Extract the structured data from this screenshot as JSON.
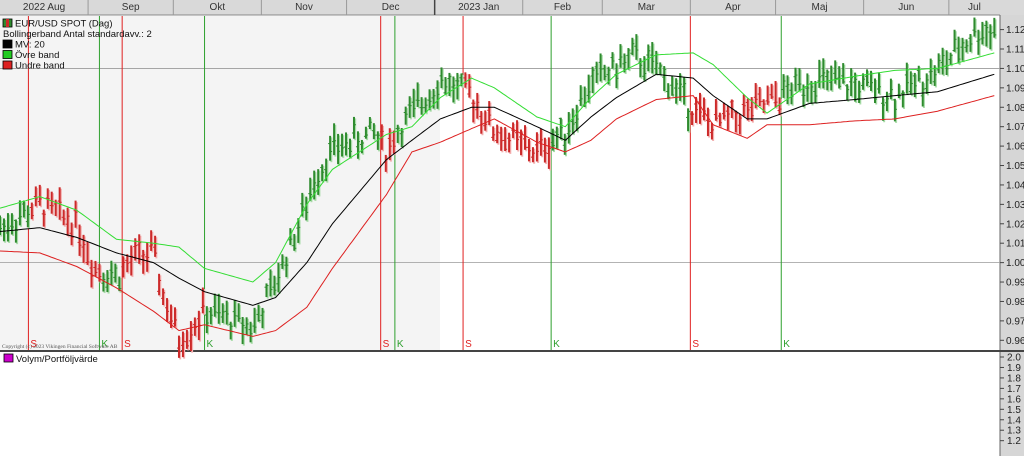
{
  "chart_data": {
    "type": "ohlc",
    "title": "EUR/USD SPOT (Dag)",
    "legend": [
      {
        "label": "EUR/USD SPOT (Dag)",
        "color": "#2e8b2e",
        "marker": "candle"
      },
      {
        "label": "Bollingerband  Antal standardavv.: 2",
        "color": "",
        "marker": "none"
      },
      {
        "label": "MV: 20",
        "color": "#000000",
        "marker": "box"
      },
      {
        "label": "Övre band",
        "color": "#22cc22",
        "marker": "box"
      },
      {
        "label": "Undre band",
        "color": "#dd2222",
        "marker": "box"
      }
    ],
    "months": [
      "2022 Aug",
      "Sep",
      "Okt",
      "Nov",
      "Dec",
      "2023 Jan",
      "Feb",
      "Mar",
      "Apr",
      "Maj",
      "Jun",
      "Jul"
    ],
    "y_ticks": [
      "1.12",
      "1.11",
      "1.10",
      "1.09",
      "1.08",
      "1.07",
      "1.06",
      "1.05",
      "1.04",
      "1.03",
      "1.02",
      "1.01",
      "1.00",
      "0.99",
      "0.98",
      "0.97",
      "0.96"
    ],
    "ylim": [
      0.955,
      1.127
    ],
    "x_range_days": [
      0,
      352
    ],
    "price": {
      "days": [
        0,
        14,
        27,
        33,
        41,
        48,
        54,
        57,
        63,
        72,
        89,
        97,
        108,
        111,
        117,
        132,
        136,
        139,
        145,
        155,
        166,
        174,
        189,
        199,
        208,
        217,
        223,
        231,
        244,
        251,
        270,
        285,
        301,
        315,
        330,
        343,
        350
      ],
      "values": [
        1.018,
        1.03,
        1.02,
        0.998,
        0.993,
        1.003,
        1.005,
        0.985,
        0.96,
        0.975,
        0.967,
        0.99,
        1.03,
        1.045,
        1.058,
        1.067,
        1.057,
        1.066,
        1.077,
        1.094,
        1.086,
        1.068,
        1.057,
        1.068,
        1.093,
        1.101,
        1.106,
        1.1,
        1.079,
        1.071,
        1.082,
        1.094,
        1.091,
        1.086,
        1.099,
        1.118,
        1.121
      ]
    },
    "mv20": {
      "days": [
        0,
        14,
        27,
        41,
        54,
        63,
        72,
        89,
        97,
        108,
        117,
        136,
        145,
        155,
        166,
        174,
        189,
        199,
        208,
        217,
        231,
        244,
        251,
        263,
        270,
        285,
        301,
        315,
        330,
        350
      ],
      "values": [
        1.016,
        1.018,
        1.013,
        1.005,
        1.0,
        0.992,
        0.985,
        0.978,
        0.982,
        1.0,
        1.02,
        1.053,
        1.063,
        1.074,
        1.08,
        1.08,
        1.07,
        1.063,
        1.075,
        1.085,
        1.097,
        1.095,
        1.086,
        1.074,
        1.074,
        1.082,
        1.084,
        1.086,
        1.088,
        1.097
      ]
    },
    "upper_band": {
      "days": [
        0,
        14,
        27,
        41,
        54,
        63,
        72,
        89,
        97,
        108,
        117,
        136,
        145,
        155,
        166,
        174,
        189,
        199,
        208,
        217,
        231,
        244,
        251,
        263,
        270,
        285,
        301,
        315,
        330,
        350
      ],
      "values": [
        1.028,
        1.034,
        1.027,
        1.012,
        1.01,
        1.008,
        0.997,
        0.99,
        1.0,
        1.03,
        1.048,
        1.066,
        1.07,
        1.085,
        1.095,
        1.09,
        1.075,
        1.07,
        1.085,
        1.097,
        1.107,
        1.108,
        1.102,
        1.085,
        1.077,
        1.092,
        1.096,
        1.099,
        1.1,
        1.108
      ]
    },
    "lower_band": {
      "days": [
        0,
        14,
        27,
        41,
        54,
        63,
        72,
        89,
        97,
        108,
        117,
        136,
        145,
        155,
        166,
        174,
        189,
        199,
        208,
        217,
        231,
        244,
        251,
        263,
        270,
        285,
        301,
        315,
        330,
        350
      ],
      "values": [
        1.006,
        1.005,
        0.998,
        0.987,
        0.975,
        0.965,
        0.968,
        0.962,
        0.965,
        0.977,
        0.997,
        1.035,
        1.057,
        1.062,
        1.069,
        1.074,
        1.062,
        1.057,
        1.063,
        1.074,
        1.084,
        1.086,
        1.071,
        1.064,
        1.071,
        1.071,
        1.073,
        1.074,
        1.078,
        1.086
      ]
    },
    "signals": [
      {
        "label": "S",
        "day": 10,
        "type": "sell"
      },
      {
        "label": "K",
        "day": 35,
        "type": "buy"
      },
      {
        "label": "S",
        "day": 43,
        "type": "sell"
      },
      {
        "label": "K",
        "day": 72,
        "type": "buy"
      },
      {
        "label": "S",
        "day": 134,
        "type": "sell"
      },
      {
        "label": "K",
        "day": 139,
        "type": "buy"
      },
      {
        "label": "S",
        "day": 163,
        "type": "sell"
      },
      {
        "label": "K",
        "day": 194,
        "type": "buy"
      },
      {
        "label": "S",
        "day": 243,
        "type": "sell"
      },
      {
        "label": "K",
        "day": 275,
        "type": "buy"
      }
    ],
    "copyright": "Copyright (c) 2023 Vikingen Financial Software AB",
    "volume_panel": {
      "legend": "Volym/Portföljvärde",
      "legend_color": "#cc00cc",
      "y_ticks": [
        "2.0",
        "1.9",
        "1.8",
        "1.7",
        "1.6",
        "1.5",
        "1.4",
        "1.3",
        "1.2"
      ],
      "ylim": [
        1.13,
        2.0
      ]
    }
  }
}
